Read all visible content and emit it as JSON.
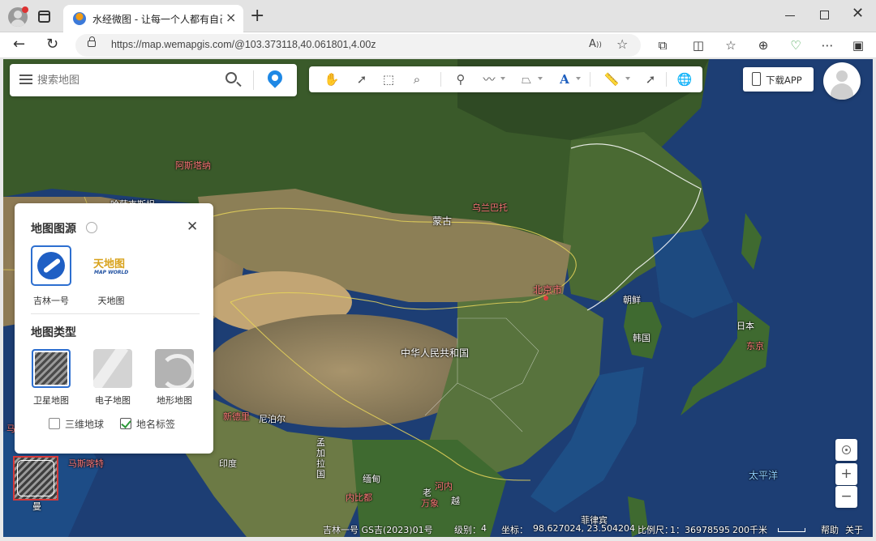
{
  "browser": {
    "tab_title": "水经微图 - 让每一个人都有自己的",
    "url": "https://map.wemapgis.com/@103.373118,40.061801,4.00z"
  },
  "search": {
    "placeholder": "搜索地图"
  },
  "download": {
    "label": "下载APP"
  },
  "panel": {
    "source_title": "地图图源",
    "sources": [
      {
        "label": "吉林一号",
        "selected": true
      },
      {
        "label": "天地图",
        "selected": false
      }
    ],
    "tianditu_logo": "天地图",
    "tianditu_sub": "MAP WORLD",
    "type_title": "地图类型",
    "types": [
      {
        "label": "卫星地图",
        "selected": true
      },
      {
        "label": "电子地图",
        "selected": false
      },
      {
        "label": "地形地图",
        "selected": false
      }
    ],
    "options": [
      {
        "label": "三维地球",
        "checked": false
      },
      {
        "label": "地名标签",
        "checked": true
      }
    ]
  },
  "map_labels": {
    "mongolia": "蒙古",
    "china": "中华人民共和国",
    "beijing": "北京市",
    "ulaanbaatar": "乌兰巴托",
    "astana": "阿斯塔纳",
    "kazakhstan": "哈萨克斯坦",
    "nepal": "尼泊尔",
    "new_delhi": "新德里",
    "india": "印度",
    "bangladesh": "孟加拉国",
    "myanmar": "缅甸",
    "hanoi": "河内",
    "laos": "老",
    "vientiane": "万象",
    "naypyidaw": "内比都",
    "vietnam": "越",
    "north_korea": "朝鲜",
    "south_korea": "韩国",
    "japan": "日本",
    "tokyo": "东京",
    "pacific": "太平洋",
    "philippines": "菲律宾",
    "maldives": "马累",
    "muscat": "马斯喀特",
    "man": "曼"
  },
  "status": {
    "attribution": "吉林一号 GS吉(2023)01号",
    "level_label": "级别：",
    "level": "4",
    "coord_label": "坐标：",
    "coords": "98.627024, 23.504204",
    "scale_label": "比例尺：",
    "scale": "1：36978595",
    "scale_distance": "200千米",
    "help": "帮助",
    "about": "关于"
  }
}
